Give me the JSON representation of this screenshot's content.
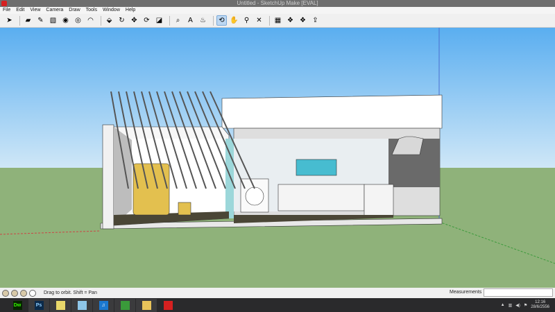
{
  "window": {
    "title": "Untitled - SketchUp Make [EVAL]"
  },
  "menu": [
    "File",
    "Edit",
    "View",
    "Camera",
    "Draw",
    "Tools",
    "Window",
    "Help"
  ],
  "toolbar": [
    {
      "icon": "select-icon",
      "glyph": "➤"
    },
    {
      "sep": true
    },
    {
      "icon": "eraser-icon",
      "glyph": "▰"
    },
    {
      "icon": "pencil-icon",
      "glyph": "✎"
    },
    {
      "icon": "rectangle-icon",
      "glyph": "▧"
    },
    {
      "icon": "circle-icon",
      "glyph": "◉"
    },
    {
      "icon": "polygon-icon",
      "glyph": "◎"
    },
    {
      "icon": "arc-icon",
      "glyph": "◠"
    },
    {
      "sep": true
    },
    {
      "icon": "push-pull-icon",
      "glyph": "⬙"
    },
    {
      "icon": "follow-me-icon",
      "glyph": "↻"
    },
    {
      "icon": "move-icon",
      "glyph": "✥"
    },
    {
      "icon": "rotate-icon",
      "glyph": "⟳"
    },
    {
      "icon": "scale-icon",
      "glyph": "◪"
    },
    {
      "sep": true
    },
    {
      "icon": "tape-measure-icon",
      "glyph": "⌕"
    },
    {
      "icon": "text-icon",
      "glyph": "A"
    },
    {
      "icon": "paint-bucket-icon",
      "glyph": "♨"
    },
    {
      "sep": true
    },
    {
      "icon": "orbit-icon",
      "glyph": "⟲",
      "active": true
    },
    {
      "icon": "pan-icon",
      "glyph": "✋"
    },
    {
      "icon": "zoom-icon",
      "glyph": "⚲"
    },
    {
      "icon": "zoom-extents-icon",
      "glyph": "✕"
    },
    {
      "sep": true
    },
    {
      "icon": "warehouse-icon",
      "glyph": "▦"
    },
    {
      "icon": "components-icon",
      "glyph": "❖"
    },
    {
      "icon": "extension-icon",
      "glyph": "❖"
    },
    {
      "icon": "share-model-icon",
      "glyph": "⇪"
    }
  ],
  "status": {
    "hint": "Drag to orbit.  Shift = Pan",
    "measurements_label": "Measurements",
    "measurements_value": ""
  },
  "taskbar": {
    "apps": [
      {
        "name": "dreamweaver",
        "label": "Dw",
        "color": "#35fa00",
        "bg": "#072401"
      },
      {
        "name": "photoshop",
        "label": "Ps",
        "color": "#8fcfff",
        "bg": "#0b2a4a"
      },
      {
        "name": "sticky-notes",
        "label": "",
        "color": "#fff",
        "bg": "#e9d86a"
      },
      {
        "name": "notepad",
        "label": "",
        "color": "#fff",
        "bg": "#8ec6e8"
      },
      {
        "name": "itunes",
        "label": "♫",
        "color": "#fff",
        "bg": "#1b78d0"
      },
      {
        "name": "chrome",
        "label": "",
        "color": "#fff",
        "bg": "#3a9a3a"
      },
      {
        "name": "file-explorer",
        "label": "",
        "color": "#fff",
        "bg": "#e8c35a"
      },
      {
        "name": "sketchup",
        "label": "",
        "color": "#fff",
        "bg": "#d62020"
      }
    ],
    "time": "12:16",
    "date": "28/6/2556"
  },
  "colors": {
    "sky_top": "#5aaef0",
    "sky_bottom": "#cfe7f7",
    "ground": "#8fb27a"
  }
}
